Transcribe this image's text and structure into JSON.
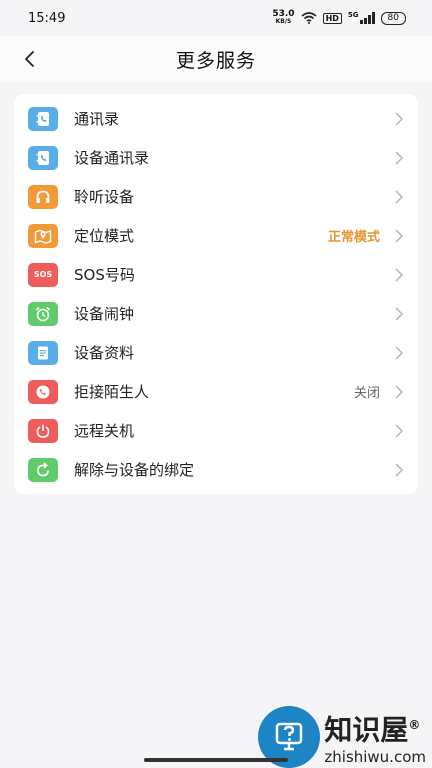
{
  "status_bar": {
    "time": "15:49",
    "net_speed_value": "53.0",
    "net_speed_unit": "KB/S",
    "hd_badge": "HD",
    "signal_label": "5G",
    "battery": "80"
  },
  "header": {
    "title": "更多服务"
  },
  "menu": [
    {
      "label": "通讯录",
      "value": "",
      "icon": "phonebook-icon",
      "color": "#5aaee8"
    },
    {
      "label": "设备通讯录",
      "value": "",
      "icon": "device-phonebook-icon",
      "color": "#5aaee8"
    },
    {
      "label": "聆听设备",
      "value": "",
      "icon": "headphones-icon",
      "color": "#f29a38"
    },
    {
      "label": "定位模式",
      "value": "正常模式",
      "icon": "map-pin-icon",
      "color": "#f29a38"
    },
    {
      "label": "SOS号码",
      "value": "",
      "icon": "sos-icon",
      "color": "#ef5c5c"
    },
    {
      "label": "设备闹钟",
      "value": "",
      "icon": "alarm-clock-icon",
      "color": "#5fcb6a"
    },
    {
      "label": "设备资料",
      "value": "",
      "icon": "document-icon",
      "color": "#5aaee8"
    },
    {
      "label": "拒接陌生人",
      "value": "关闭",
      "icon": "reject-call-icon",
      "color": "#ef5c5c"
    },
    {
      "label": "远程关机",
      "value": "",
      "icon": "power-icon",
      "color": "#ef5c5c"
    },
    {
      "label": "解除与设备的绑定",
      "value": "",
      "icon": "refresh-icon",
      "color": "#5fcb6a"
    }
  ],
  "sos_icon_text": "SOS",
  "watermark": {
    "main": "知识屋",
    "sub": "zhishiwu.com",
    "registered": "®"
  }
}
